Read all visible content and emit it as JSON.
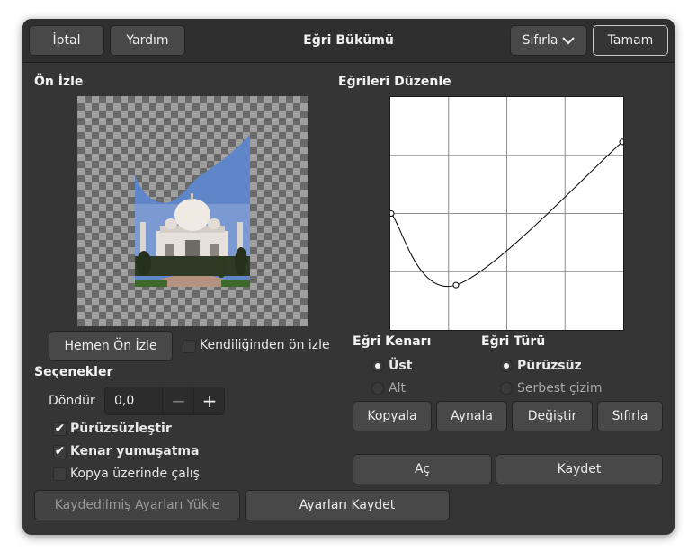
{
  "header": {
    "cancel_label": "İptal",
    "help_label": "Yardım",
    "title": "Eğri Bükümü",
    "reset_label": "Sıfırla",
    "ok_label": "Tamam"
  },
  "preview": {
    "heading": "Ön İzle",
    "preview_now_label": "Hemen Ön İzle",
    "auto_preview_label": "Kendiliğinden ön izle",
    "auto_preview_checked": false
  },
  "options": {
    "heading": "Seçenekler",
    "rotate_label": "Döndür",
    "rotate_value": "0,0",
    "smoothing_label": "Pürüzsüzleştir",
    "smoothing_checked": true,
    "antialias_label": "Kenar yumuşatma",
    "antialias_checked": true,
    "work_on_copy_label": "Kopya üzerinde çalış",
    "work_on_copy_checked": false
  },
  "curves": {
    "heading": "Eğrileri Düzenle",
    "edge_heading": "Eğri Kenarı",
    "edge_upper": "Üst",
    "edge_lower": "Alt",
    "edge_selected": "Üst",
    "type_heading": "Eğri Türü",
    "type_smooth": "Pürüzsüz",
    "type_free": "Serbest çizim",
    "type_selected": "Pürüzsüz",
    "points": [
      {
        "x": 0.0,
        "y": 0.5
      },
      {
        "x": 0.28,
        "y": 0.19
      },
      {
        "x": 1.0,
        "y": 0.81
      }
    ]
  },
  "curve_buttons": {
    "copy": "Kopyala",
    "mirror": "Aynala",
    "swap": "Değiştir",
    "reset": "Sıfırla",
    "open": "Aç",
    "save": "Kaydet"
  },
  "footer": {
    "load_settings_label": "Kaydedilmiş Ayarları Yükle",
    "save_settings_label": "Ayarları Kaydet"
  },
  "colors": {
    "dialog_bg": "#353535",
    "button_bg": "#484848",
    "sky": "#5f86c9"
  },
  "icons": {
    "dropdown": "chevron-down-icon",
    "check": "check-icon",
    "minus": "minus-icon",
    "plus": "plus-icon"
  }
}
